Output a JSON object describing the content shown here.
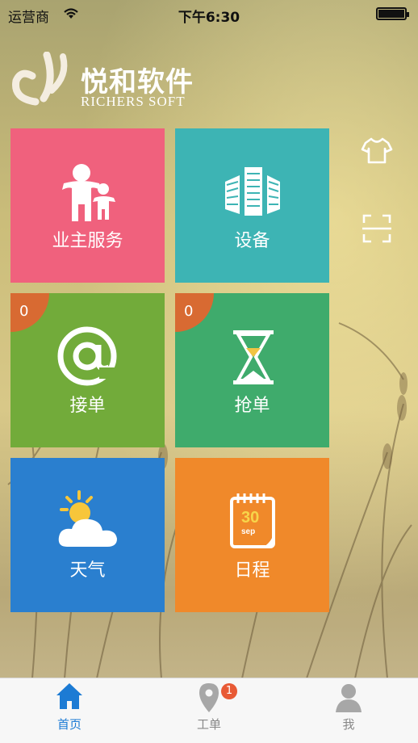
{
  "status_bar": {
    "carrier": "运营商",
    "time": "下午6:30"
  },
  "logo": {
    "brand": "悦和软件",
    "subtitle": "RICHERS SOFT"
  },
  "tiles": [
    {
      "label": "业主服务",
      "color": "#f0617d",
      "icon": "family-icon"
    },
    {
      "label": "设备",
      "color": "#3db4b4",
      "icon": "buildings-icon"
    },
    {
      "label": "接单",
      "color": "#72ab3a",
      "icon": "at-sign-icon",
      "badge": "0"
    },
    {
      "label": "抢单",
      "color": "#3fab6c",
      "icon": "hourglass-icon",
      "badge": "0"
    },
    {
      "label": "天气",
      "color": "#2a7fcf",
      "icon": "weather-icon"
    },
    {
      "label": "日程",
      "color": "#f0892a",
      "icon": "calendar-icon",
      "calendar_day": "30",
      "calendar_month": "sep"
    }
  ],
  "side_icons": [
    "shirt-icon",
    "scan-icon"
  ],
  "tabbar": {
    "items": [
      {
        "label": "首页",
        "icon": "home-icon",
        "active": true
      },
      {
        "label": "工单",
        "icon": "location-pin-icon",
        "badge": "1"
      },
      {
        "label": "我",
        "icon": "person-icon"
      }
    ],
    "active_color": "#1c7bd4"
  }
}
